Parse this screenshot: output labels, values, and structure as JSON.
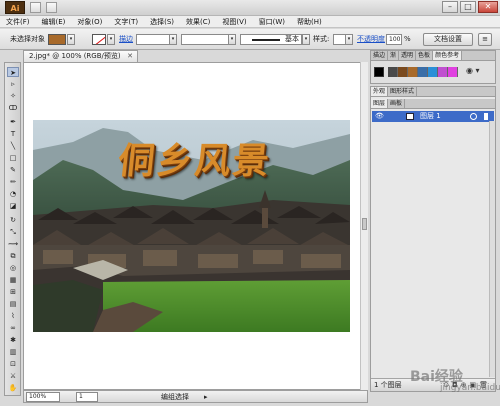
{
  "app": {
    "logo": "Ai"
  },
  "menu": [
    "文件(F)",
    "编辑(E)",
    "对象(O)",
    "文字(T)",
    "选择(S)",
    "效果(C)",
    "视图(V)",
    "窗口(W)",
    "帮助(H)"
  ],
  "controlbar": {
    "selection_label": "未选择对象",
    "stroke_link": "描边",
    "stroke_style": "基本",
    "style_label": "样式:",
    "opacity_link": "不透明度",
    "opacity_value": "100",
    "opacity_unit": "%",
    "doc_setup_button": "文档设置",
    "colors": {
      "fill": "#a86a2b",
      "link": "#1a4fc7"
    }
  },
  "document": {
    "tab_title": "2.jpg* @ 100% (RGB/预览)",
    "artwork_title": "侗乡风景"
  },
  "statusbar": {
    "zoom": "100%",
    "artboard": "1",
    "tool_status": "编组选择"
  },
  "panels": {
    "top_tabs": [
      "描边",
      "渐",
      "透明",
      "色板",
      "颜色参考"
    ],
    "appearance_tabs": [
      "外观",
      "图形样式"
    ],
    "layer_tabs": [
      "图层",
      "画板"
    ],
    "layer_name": "图层 1",
    "layer_count": "1 个图层",
    "guide_colors": [
      "#4a4a4a",
      "#7a4a1e",
      "#a86a2b",
      "#3a6ea8",
      "#2b8fd8",
      "#c04fd0",
      "#e040e0"
    ]
  },
  "watermark": {
    "text": "Bai经验",
    "sub": "jingyan.baidu.com"
  },
  "icons": [
    "close-icon",
    "minimize-icon",
    "maximize-icon",
    "eye-icon",
    "new-layer-icon",
    "delete-layer-icon"
  ]
}
